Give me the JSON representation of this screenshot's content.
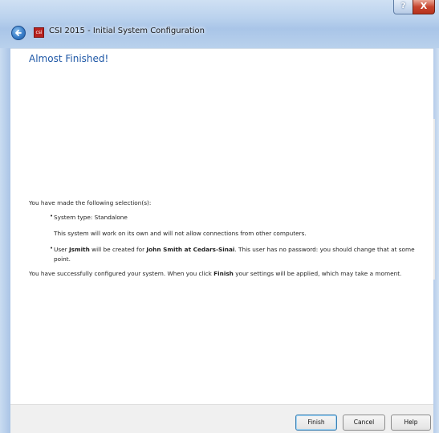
{
  "window": {
    "title": "CSI 2015 - Initial System Configuration",
    "app_icon_text": "csi",
    "caption_help": "?",
    "caption_close": "X"
  },
  "main": {
    "heading": "Almost Finished!",
    "selections_intro": "You have made the following selection(s):",
    "system_type_bullet": "System type: Standalone",
    "system_type_detail": "This system will work on its own and will not allow connections from other computers.",
    "user_bullet": {
      "prefix": "User ",
      "username": "Jsmith",
      "mid": " will be created for ",
      "fullname": "John Smith at Cedars-Sinai",
      "suffix": ". This user has no password: you should change that at some",
      "line2": "point."
    },
    "summary": {
      "prefix": "You have successfully configured your system. When you click ",
      "keyword": "Finish",
      "suffix": " your settings will be applied, which may take a moment."
    }
  },
  "footer": {
    "finish_label": "Finish",
    "cancel_label": "Cancel",
    "help_label": "Help"
  },
  "colors": {
    "heading": "#1e57a6",
    "title_bar": "#bcd3ee",
    "close_button": "#c7452f"
  }
}
